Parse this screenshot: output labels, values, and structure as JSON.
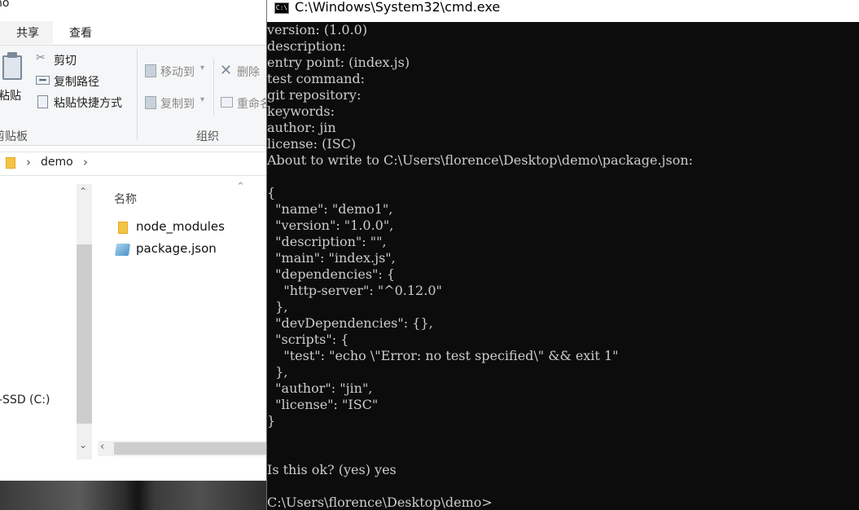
{
  "explorer": {
    "title_fragment": "no",
    "tabs": [
      {
        "label": "共享"
      },
      {
        "label": "查看"
      }
    ],
    "ribbon": {
      "paste": "粘贴",
      "cut": "剪切",
      "copy_path": "复制路径",
      "paste_shortcut": "粘贴快捷方式",
      "move_to": "移动到",
      "copy_to": "复制到",
      "delete": "删除",
      "rename": "重命名",
      "group_clipboard": "剪贴板",
      "group_organize": "组织"
    },
    "address": {
      "path": "demo"
    },
    "nav": {
      "drive_label": "-SSD (C:)"
    },
    "content": {
      "column_name": "名称",
      "files": [
        {
          "name": "node_modules",
          "type": "folder"
        },
        {
          "name": "package.json",
          "type": "json"
        }
      ]
    }
  },
  "cmd": {
    "title": "C:\\Windows\\System32\\cmd.exe",
    "icon_text": "C:\\",
    "lines": [
      "version: (1.0.0)",
      "description:",
      "entry point: (index.js)",
      "test command:",
      "git repository:",
      "keywords:",
      "author: jin",
      "license: (ISC)",
      "About to write to C:\\Users\\florence\\Desktop\\demo\\package.json:",
      "",
      "{",
      "  \"name\": \"demo1\",",
      "  \"version\": \"1.0.0\",",
      "  \"description\": \"\",",
      "  \"main\": \"index.js\",",
      "  \"dependencies\": {",
      "    \"http-server\": \"^0.12.0\"",
      "  },",
      "  \"devDependencies\": {},",
      "  \"scripts\": {",
      "    \"test\": \"echo \\\"Error: no test specified\\\" && exit 1\"",
      "  },",
      "  \"author\": \"jin\",",
      "  \"license\": \"ISC\"",
      "}",
      "",
      "",
      "Is this ok? (yes) yes",
      "",
      "C:\\Users\\florence\\Desktop\\demo>"
    ]
  }
}
